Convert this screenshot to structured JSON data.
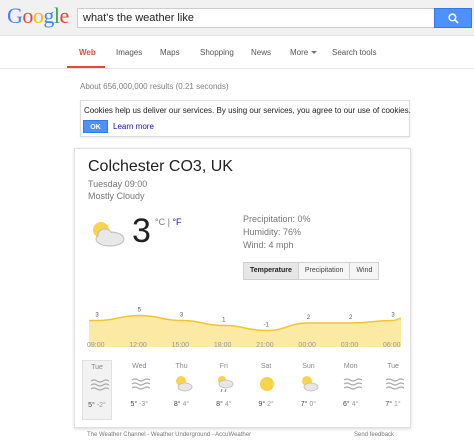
{
  "header": {
    "logo_letters": [
      "G",
      "o",
      "o",
      "g",
      "l",
      "e"
    ],
    "query": "what's the weather like",
    "search_button_icon": "search-icon"
  },
  "tabs": [
    {
      "label": "Web",
      "active": true
    },
    {
      "label": "Images"
    },
    {
      "label": "Maps"
    },
    {
      "label": "Shopping"
    },
    {
      "label": "News"
    },
    {
      "label": "More"
    },
    {
      "label": "Search tools"
    }
  ],
  "results_count": "About 656,000,000 results (0.21 seconds)",
  "cookie_notice": {
    "text": "Cookies help us deliver our services. By using our services, you agree to our use of cookies.",
    "ok_label": "OK",
    "learn_more_label": "Learn more"
  },
  "weather": {
    "location": "Colchester CO3, UK",
    "datetime": "Tuesday 09:00",
    "condition": "Mostly Cloudy",
    "condition_icon": "partly-cloudy-icon",
    "temperature": "3",
    "unit_c": "°C",
    "unit_separator": " | ",
    "unit_f": "°F",
    "precipitation": "Precipitation: 0%",
    "humidity": "Humidity: 76%",
    "wind": "Wind: 4 mph",
    "view_tabs": [
      {
        "label": "Temperature",
        "active": true
      },
      {
        "label": "Precipitation"
      },
      {
        "label": "Wind"
      }
    ],
    "chart_data": {
      "type": "area",
      "x": [
        "09:00",
        "12:00",
        "15:00",
        "18:00",
        "21:00",
        "00:00",
        "03:00",
        "06:00"
      ],
      "point_labels": [
        {
          "x": "09:00",
          "label": "3"
        },
        {
          "x": "12:00",
          "label": "5"
        },
        {
          "x": "15:00",
          "label": "3"
        },
        {
          "x": "18:00",
          "label": "1"
        },
        {
          "x": "21:00",
          "label": "-1"
        },
        {
          "x": "00:00",
          "label": "2"
        },
        {
          "x": "03:00",
          "label": "2"
        },
        {
          "x": "06:00",
          "label": "3"
        }
      ],
      "color": "#f4c430"
    },
    "forecast": [
      {
        "day": "Tue",
        "icon": "fog-icon",
        "high": "5°",
        "low": "-2°",
        "selected": true
      },
      {
        "day": "Wed",
        "icon": "fog-icon",
        "high": "5°",
        "low": "-3°"
      },
      {
        "day": "Thu",
        "icon": "partly-cloudy-icon",
        "high": "8°",
        "low": "4°"
      },
      {
        "day": "Fri",
        "icon": "rain-icon",
        "high": "8°",
        "low": "4°"
      },
      {
        "day": "Sat",
        "icon": "sunny-icon",
        "high": "9°",
        "low": "2°"
      },
      {
        "day": "Sun",
        "icon": "partly-cloudy-icon",
        "high": "7°",
        "low": "0°"
      },
      {
        "day": "Mon",
        "icon": "fog-icon",
        "high": "6°",
        "low": "4°"
      },
      {
        "day": "Tue",
        "icon": "fog-icon",
        "high": "7°",
        "low": "1°"
      }
    ]
  },
  "footer": {
    "sources": "The Weather Channel - Weather Underground - AccuWeather",
    "feedback": "Send feedback"
  },
  "colors": {
    "brand_blue": "#4285f4",
    "active_tab": "#dd4b39",
    "button_blue": "#4d90fe",
    "chart_fill": "#f4c430"
  }
}
